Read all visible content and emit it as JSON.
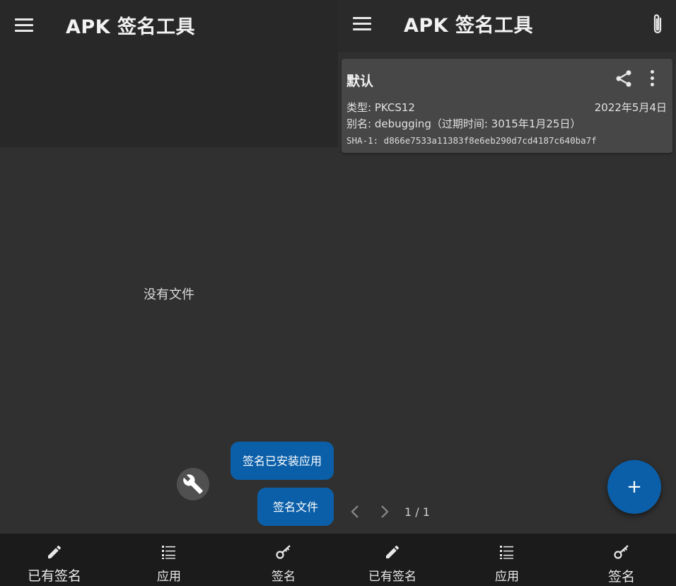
{
  "left_screen": {
    "app_title": "APK 签名工具",
    "empty_message": "没有文件",
    "actions": {
      "sign_installed_label": "签名已安装应用",
      "sign_file_label": "签名文件"
    },
    "bottom_nav": [
      {
        "label": "已有签名",
        "icon": "pencil-icon"
      },
      {
        "label": "应用",
        "icon": "list-icon"
      },
      {
        "label": "签名",
        "icon": "key-icon"
      }
    ]
  },
  "right_screen": {
    "app_title": "APK 签名工具",
    "keystore_card": {
      "title": "默认",
      "type_line": "类型: PKCS12",
      "date": "2022年5月4日",
      "alias_line": "别名: debugging（过期时间: 3015年1月25日）",
      "sha1_line": "SHA-1: d866e7533a11383f8e6eb290d7cd4187c640ba7f"
    },
    "pager": {
      "text": "1 / 1"
    },
    "fab_label": "+",
    "bottom_nav": [
      {
        "label": "已有签名",
        "icon": "pencil-icon"
      },
      {
        "label": "应用",
        "icon": "list-icon"
      },
      {
        "label": "签名",
        "icon": "key-icon"
      }
    ]
  },
  "colors": {
    "background": "#303030",
    "appbar": "#2a2a2a",
    "accent": "#0b5fa8",
    "card": "#474747",
    "bottom_nav": "#1b1b1b"
  }
}
